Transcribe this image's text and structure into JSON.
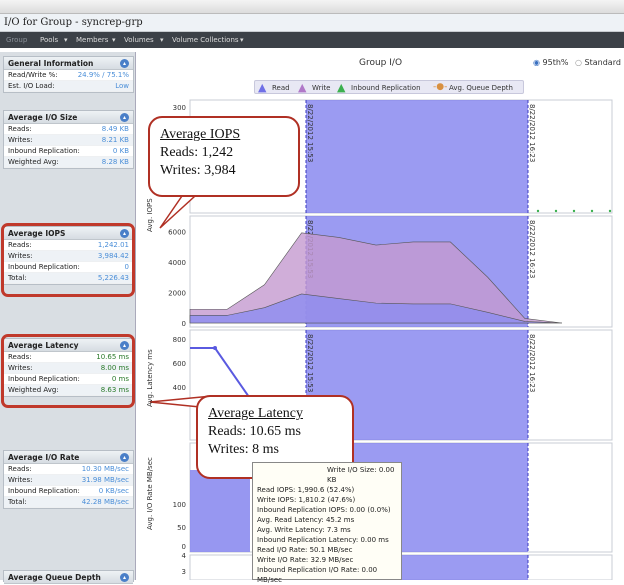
{
  "window": {
    "title": "I/O for Group - syncrep-grp"
  },
  "menu": {
    "items": [
      "Group",
      "Pools",
      "Members",
      "Volumes",
      "Volume Collections"
    ]
  },
  "sidebar": {
    "general": {
      "title": "General Information",
      "rows": [
        {
          "label": "Read/Write %:",
          "value": "24.9% / 75.1%"
        },
        {
          "label": "Est. I/O Load:",
          "value": "Low"
        }
      ]
    },
    "avg_io_size": {
      "title": "Average I/O Size",
      "rows": [
        {
          "label": "Reads:",
          "value": "8.49 KB"
        },
        {
          "label": "Writes:",
          "value": "8.21 KB"
        },
        {
          "label": "Inbound Replication:",
          "value": "0 KB"
        },
        {
          "label": "Weighted Avg:",
          "value": "8.28 KB"
        }
      ]
    },
    "avg_iops": {
      "title": "Average IOPS",
      "rows": [
        {
          "label": "Reads:",
          "value": "1,242.01"
        },
        {
          "label": "Writes:",
          "value": "3,984.42"
        },
        {
          "label": "Inbound Replication:",
          "value": "0"
        },
        {
          "label": "Total:",
          "value": "5,226.43"
        }
      ]
    },
    "avg_latency": {
      "title": "Average Latency",
      "rows": [
        {
          "label": "Reads:",
          "value": "10.65 ms"
        },
        {
          "label": "Writes:",
          "value": "8.00 ms"
        },
        {
          "label": "Inbound Replication:",
          "value": "0 ms"
        },
        {
          "label": "Weighted Avg:",
          "value": "8.63 ms"
        }
      ]
    },
    "avg_io_rate": {
      "title": "Average I/O Rate",
      "rows": [
        {
          "label": "Reads:",
          "value": "10.30 MB/sec"
        },
        {
          "label": "Writes:",
          "value": "31.98 MB/sec"
        },
        {
          "label": "Inbound Replication:",
          "value": "0 KB/sec"
        },
        {
          "label": "Total:",
          "value": "42.28 MB/sec"
        }
      ]
    },
    "avg_queue_depth": {
      "title": "Average Queue Depth"
    }
  },
  "chart_header": {
    "title": "Group I/O",
    "radio_95th": "95th%",
    "radio_standard": "Standard",
    "legend": [
      "Read",
      "Write",
      "Inbound Replication",
      "Avg. Queue Depth"
    ]
  },
  "colors": {
    "read": "#8c8cf0",
    "write": "#c49ad0",
    "inbound": "#3cb050",
    "queue": "#d89040",
    "band": "#7a7aee",
    "callout_border": "#b03024"
  },
  "callout_iops": {
    "title": "Average IOPS",
    "line1": "Reads: 1,242",
    "line2": "Writes: 3,984"
  },
  "callout_latency": {
    "title": "Average Latency",
    "line1": "Reads: 10.65 ms",
    "line2": "Writes: 8 ms"
  },
  "timestamps": {
    "start": "8/22/2012 15:53",
    "end": "8/22/2012 16:23"
  },
  "axes": {
    "iops": "Avg. IOPS",
    "latency": "Avg. Latency ms",
    "rate": "Avg. I/O Rate MB/sec"
  },
  "tooltip": {
    "lines": [
      "Write I/O Size: 0.00 KB",
      "Read IOPS: 1,990.6 (52.4%)",
      "Write IOPS: 1,810.2 (47.6%)",
      "Inbound Replication IOPS: 0.00 (0.0%)",
      "Avg. Read Latency: 45.2 ms",
      "Avg. Write Latency: 7.3 ms",
      "Inbound Replication Latency: 0.00 ms",
      "Read I/O Rate: 50.1 MB/sec",
      "Write I/O Rate: 32.9 MB/sec",
      "Inbound Replication I/O Rate: 0.00 MB/sec"
    ]
  },
  "chart_data": [
    {
      "type": "line",
      "title": "Group I/O",
      "ytick_labels": [
        "300"
      ],
      "series": [
        {
          "name": "Avg. Queue Depth",
          "x": [],
          "y": []
        }
      ]
    },
    {
      "type": "area",
      "ylabel": "Avg. IOPS",
      "ytick_labels": [
        "6000",
        "4000",
        "2000",
        "0"
      ],
      "ylim": [
        0,
        7000
      ],
      "series": [
        {
          "name": "Write",
          "values": [
            900,
            900,
            2500,
            5900,
            5600,
            5100,
            5300,
            5300,
            3000,
            300,
            0
          ]
        },
        {
          "name": "Read",
          "values": [
            500,
            500,
            1000,
            1900,
            1600,
            1300,
            1250,
            1250,
            700,
            100,
            0
          ]
        }
      ]
    },
    {
      "type": "line",
      "ylabel": "Avg. Latency ms",
      "ytick_labels": [
        "800",
        "600",
        "400"
      ],
      "series": [
        {
          "name": "Read",
          "values": [
            760,
            760,
            400
          ]
        }
      ]
    },
    {
      "type": "area",
      "ylabel": "Avg. I/O Rate MB/sec",
      "ytick_labels": [
        "100",
        "50",
        "0"
      ]
    },
    {
      "type": "area",
      "ytick_labels": [
        "4",
        "3"
      ]
    }
  ]
}
